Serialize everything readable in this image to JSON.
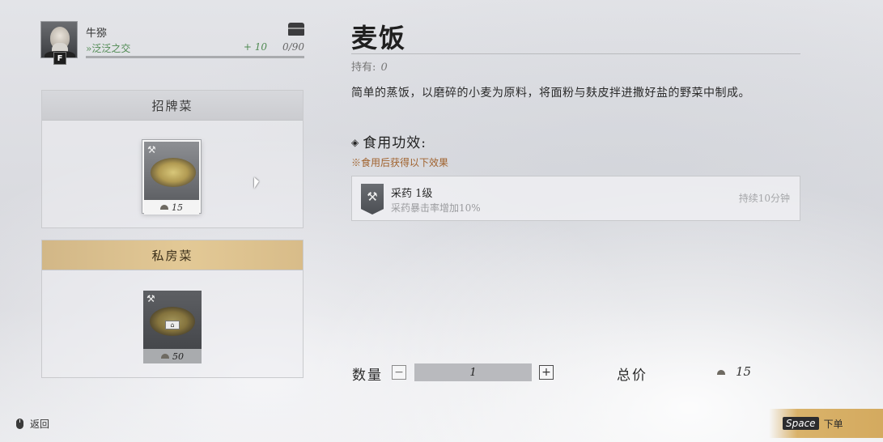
{
  "npc": {
    "name": "牛猕",
    "relation": "»泛泛之交",
    "gain": "+ 10",
    "progress": "0/90",
    "interact_key": "F",
    "chest_icon": "chest-icon"
  },
  "menu": {
    "signature": {
      "title": "招牌菜",
      "dish": {
        "price": "15",
        "state": "selected"
      }
    },
    "private": {
      "title": "私房菜",
      "dish": {
        "price": "50",
        "state": "locked"
      }
    }
  },
  "detail": {
    "name": "麦饭",
    "owned_label": "持有:",
    "owned_count": "0",
    "description": "简单的蒸饭，以磨碎的小麦为原料，将面粉与麸皮拌进撒好盐的野菜中制成。",
    "effect_heading": "食用功效:",
    "effect_note": "※食用后获得以下效果",
    "effect": {
      "icon": "gathering-tools-icon",
      "name": "采药 1级",
      "desc": "采药暴击率增加10%",
      "duration": "持续10分钟"
    }
  },
  "order": {
    "qty_label": "数量",
    "minus": "−",
    "plus": "+",
    "quantity": "1",
    "total_label": "总价",
    "total_value": "15"
  },
  "footer": {
    "back_label": "返回",
    "confirm_key": "Space",
    "confirm_label": "下单"
  },
  "colors": {
    "accent_gold": "#d9b26a",
    "relation_green": "#4f8a52",
    "note_orange": "#a0622d"
  }
}
